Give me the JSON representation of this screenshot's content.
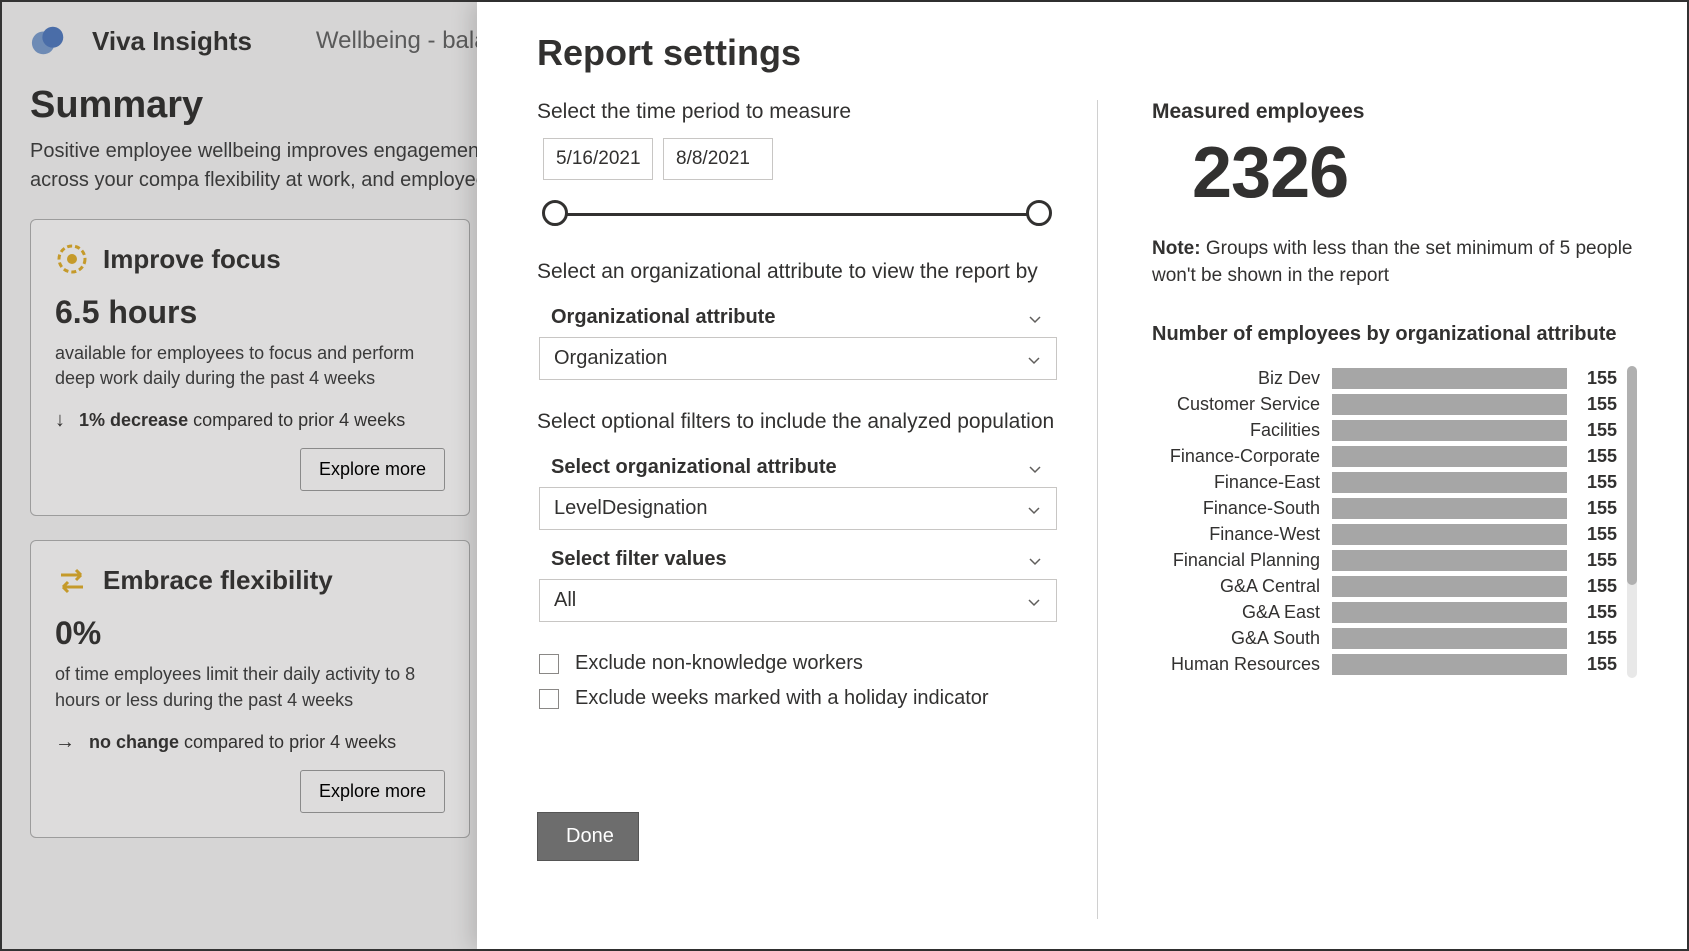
{
  "bg": {
    "appName": "Viva Insights",
    "breadcrumb": "Wellbeing - bala",
    "pageTitle": "Summary",
    "description": "Positive employee wellbeing improves engagement,  insights into employee wellbeing across your compa flexibility at work, and employees' sense of commun",
    "focusCard": {
      "title": "Improve focus",
      "value": "6.5 hours",
      "subtitle": "available for employees to focus and perform deep work daily during the past 4 weeks",
      "trendBold": "1% decrease",
      "trendRest": " compared to prior 4 weeks",
      "button": "Explore more"
    },
    "flexCard": {
      "title": "Embrace flexibility",
      "value": "0%",
      "subtitle": "of time employees limit their daily activity to 8 hours or less during the past 4 weeks",
      "trendBold": "no change",
      "trendRest": " compared to prior 4 weeks",
      "button": "Explore more"
    }
  },
  "panel": {
    "title": "Report settings",
    "timeLabel": "Select the time period to measure",
    "dateStart": "5/16/2021",
    "dateEnd": "8/8/2021",
    "orgAttrLabel": "Select an organizational attribute to view the report by",
    "orgAttrDropLabel": "Organizational attribute",
    "orgAttrValue": "Organization",
    "filterLabel": "Select optional filters to include the analyzed population",
    "filterDropLabel": "Select organizational attribute",
    "filterValue": "LevelDesignation",
    "filterValuesLabel": "Select filter values",
    "filterValuesValue": "All",
    "excludeNonKnowledge": "Exclude non-knowledge workers",
    "excludeHoliday": "Exclude weeks marked with a holiday indicator",
    "done": "Done"
  },
  "right": {
    "measuredLabel": "Measured employees",
    "measuredValue": "2326",
    "noteBold": "Note:",
    "noteText": " Groups with less than the set minimum of 5 people won't be shown in the report",
    "chartTitle": "Number of employees by organizational attribute"
  },
  "chart_data": {
    "type": "bar",
    "title": "Number of employees by organizational attribute",
    "categories": [
      "Biz Dev",
      "Customer Service",
      "Facilities",
      "Finance-Corporate",
      "Finance-East",
      "Finance-South",
      "Finance-West",
      "Financial Planning",
      "G&A Central",
      "G&A East",
      "G&A South",
      "Human Resources"
    ],
    "values": [
      155,
      155,
      155,
      155,
      155,
      155,
      155,
      155,
      155,
      155,
      155,
      155
    ],
    "xlabel": "",
    "ylabel": "",
    "ylim": [
      0,
      155
    ]
  }
}
